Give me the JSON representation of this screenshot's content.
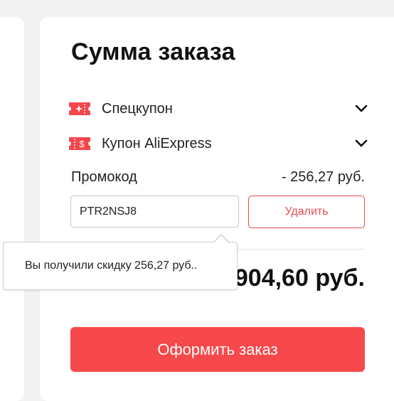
{
  "summary": {
    "title": "Сумма заказа"
  },
  "coupons": [
    {
      "label": "Спецкупон",
      "icon": "special-coupon-icon"
    },
    {
      "label": "Купон AliExpress",
      "icon": "aliexpress-coupon-icon"
    }
  ],
  "promo": {
    "label": "Промокод",
    "discount": "- 256,27 руб.",
    "code": "PTR2NSJ8",
    "delete_label": "Удалить"
  },
  "tooltip": {
    "text": "Вы получили скидку 256,27 руб.."
  },
  "total": {
    "value": "904,60 руб."
  },
  "checkout": {
    "label": "Оформить заказ"
  },
  "colors": {
    "accent": "#f7484b",
    "accent_border": "#e8494e",
    "background": "#f2f2f2",
    "card": "#ffffff"
  }
}
